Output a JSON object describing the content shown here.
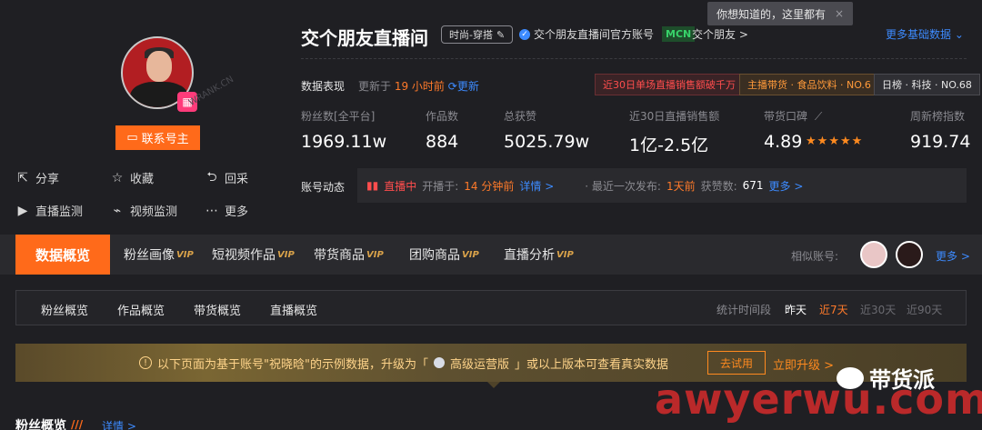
{
  "profile": {
    "contact_label": "联系号主",
    "watermark": "WRANK.CN",
    "actions": [
      {
        "icon": "share-icon",
        "glyph": "⇱",
        "label": "分享"
      },
      {
        "icon": "star-icon",
        "glyph": "☆",
        "label": "收藏"
      },
      {
        "icon": "back-icon",
        "glyph": "⮌",
        "label": "回采"
      },
      {
        "icon": "live-monitor-icon",
        "glyph": "▶",
        "label": "直播监测"
      },
      {
        "icon": "video-monitor-icon",
        "glyph": "⌁",
        "label": "视频监测"
      },
      {
        "icon": "more-icon",
        "glyph": "⋯",
        "label": "更多"
      }
    ]
  },
  "header": {
    "name": "交个朋友直播间",
    "category": "时尚-穿搭",
    "verified": "交个朋友直播间官方账号",
    "mcn_badge": "MCN",
    "mcn_name": "交个朋友 >",
    "tooltip": "你想知道的，这里都有",
    "more_data": "更多基础数据 ⌄"
  },
  "performance": {
    "label": "数据表现",
    "updated_prefix": "更新于",
    "updated_value": "19 小时前",
    "refresh": "更新",
    "tags": [
      {
        "text": "近30日单场直播销售额破千万",
        "fg": "#ff4d4d",
        "bg": "#3a2326",
        "border": "#6a2f33"
      },
      {
        "text": "主播带货 · 食品饮料 · NO.6",
        "fg": "#ff9a3a",
        "bg": "#3a2e22",
        "border": "#6a4f2f"
      },
      {
        "text": "日榜 · 科技 · NO.68",
        "fg": "#e6e6e6",
        "bg": "#2f2f34",
        "border": "#4a4a50"
      }
    ]
  },
  "stats": [
    {
      "label": "粉丝数[全平台]",
      "value": "1969.11w"
    },
    {
      "label": "作品数",
      "value": "884"
    },
    {
      "label": "总获赞",
      "value": "5025.79w"
    },
    {
      "label": "近30日直播销售额",
      "value": "1亿-2.5亿"
    },
    {
      "label": "带货口碑",
      "value": "4.89"
    },
    {
      "label": "周新榜指数",
      "value": "919.74"
    }
  ],
  "rating": {
    "stars": 5
  },
  "dynamics": {
    "label": "账号动态",
    "live": "直播中",
    "started_prefix": "开播于:",
    "started_value": "14 分钟前",
    "details": "详情 >",
    "last_publish_prefix": "· 最近一次发布:",
    "last_publish_value": "1天前",
    "likes_prefix": "获赞数:",
    "likes_value": "671",
    "more": "更多 >"
  },
  "nav": {
    "active": "数据概览",
    "tabs": [
      {
        "label": "粉丝画像",
        "vip": "VIP"
      },
      {
        "label": "短视频作品",
        "vip": "VIP"
      },
      {
        "label": "带货商品",
        "vip": "VIP"
      },
      {
        "label": "团购商品",
        "vip": "VIP"
      },
      {
        "label": "直播分析",
        "vip": "VIP"
      }
    ],
    "similar_label": "相似账号:",
    "more": "更多 >"
  },
  "subtabs": {
    "items": [
      "粉丝概览",
      "作品概览",
      "带货概览",
      "直播概览"
    ],
    "period_label": "统计时间段",
    "ranges": [
      {
        "label": "昨天",
        "state": "normal"
      },
      {
        "label": "近7天",
        "state": "active"
      },
      {
        "label": "近30天",
        "state": "dim"
      },
      {
        "label": "近90天",
        "state": "dim"
      }
    ]
  },
  "notice": {
    "text": "以下页面为基于账号\"祝晓晗\"的示例数据，升级为「",
    "tier": "高级运营版",
    "text_after": "」或以上版本可查看真实数据",
    "trial": "去试用",
    "upgrade": "立即升级 >"
  },
  "section": {
    "title": "粉丝概览",
    "detail": "详情 >"
  },
  "overlay": {
    "brand_cn": "带货派",
    "brand_en": "awyerwu.com"
  }
}
